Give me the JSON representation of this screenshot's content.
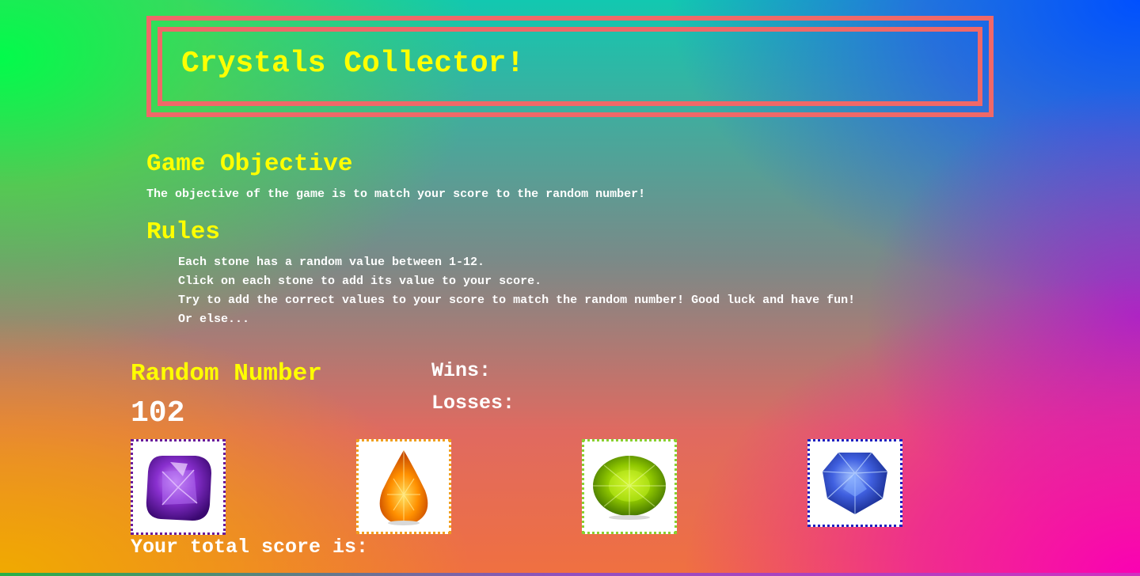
{
  "header": {
    "title": "Crystals Collector!"
  },
  "objective": {
    "heading": "Game Objective",
    "text": "The objective of the game is to match your score to the random number!"
  },
  "rules": {
    "heading": "Rules",
    "items": [
      "Each stone has a random value between 1-12.",
      "Click on each stone to add its value to your score.",
      "Try to add the correct values to your score to match the random number! Good luck and have fun!",
      "Or else..."
    ]
  },
  "random_number": {
    "label": "Random Number",
    "value": "102"
  },
  "stats": {
    "wins_label": "Wins:",
    "losses_label": "Losses:"
  },
  "score": {
    "label": "Your total score is:"
  },
  "crystals": [
    {
      "icon": "amethyst-icon",
      "border_color": "#6a1a9a"
    },
    {
      "icon": "citrine-icon",
      "border_color": "#f0a020"
    },
    {
      "icon": "peridot-icon",
      "border_color": "#8ad030"
    },
    {
      "icon": "sapphire-icon",
      "border_color": "#2020c0"
    }
  ],
  "colors": {
    "heading": "#ffff00",
    "text": "#ffffff",
    "header_border": "#f06868"
  }
}
